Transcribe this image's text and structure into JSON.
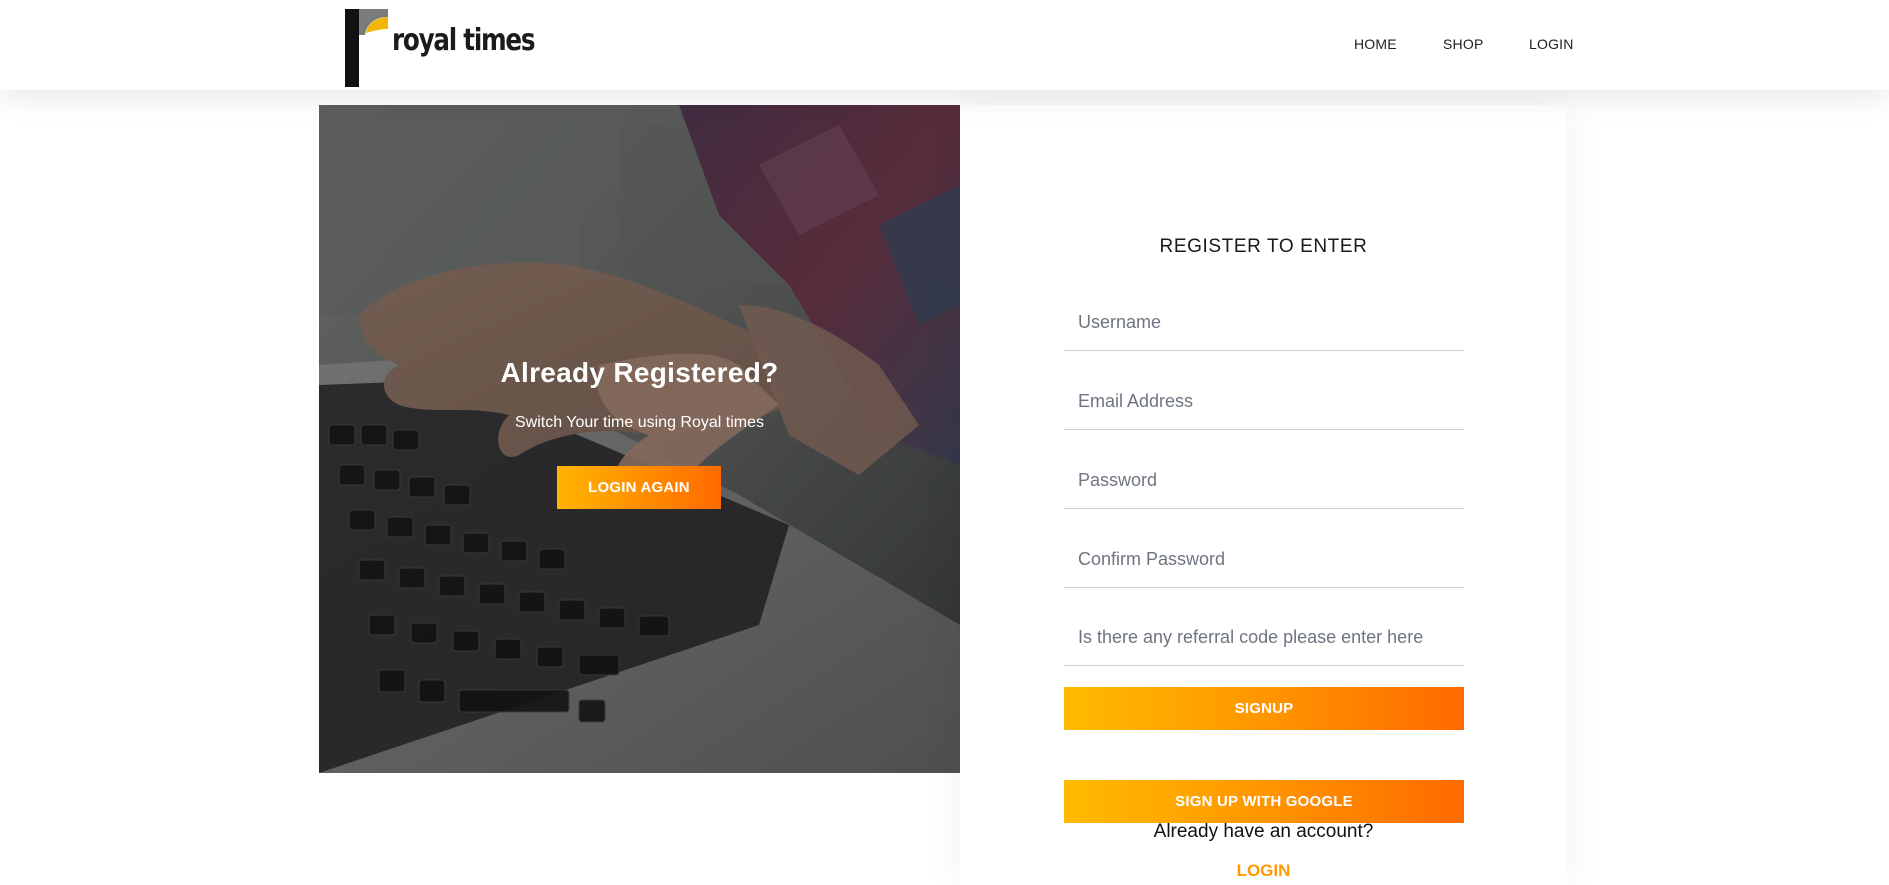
{
  "header": {
    "logo_text": "royal times",
    "nav": {
      "home": "HOME",
      "shop": "SHOP",
      "login": "LOGIN"
    }
  },
  "hero": {
    "title": "Already Registered?",
    "subtitle": "Switch Your time using Royal times",
    "button_label": "LOGIN AGAIN"
  },
  "form": {
    "title": "REGISTER TO ENTER",
    "fields": {
      "username_placeholder": "Username",
      "email_placeholder": "Email Address",
      "password_placeholder": "Password",
      "confirm_password_placeholder": "Confirm Password",
      "referral_placeholder": "Is there any referral code please enter here"
    },
    "signup_label": "SIGNUP",
    "google_label": "SIGN UP WITH GOOGLE",
    "already_text": "Already have an account?",
    "login_link": "LOGIN"
  },
  "colors": {
    "accent_start": "#ffb400",
    "accent_end": "#ff6a00"
  }
}
